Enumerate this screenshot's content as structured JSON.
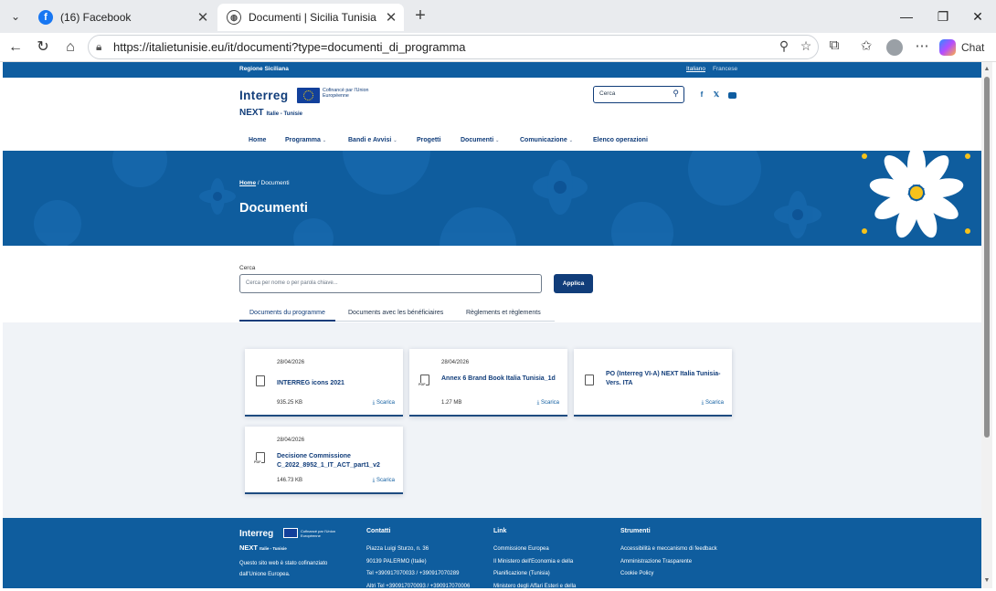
{
  "browser": {
    "tabs": [
      {
        "title": "(16) Facebook",
        "icon": "facebook-icon"
      },
      {
        "title": "Documenti | Sicilia Tunisia",
        "icon": "globe-icon"
      }
    ],
    "url": "https://italietunisie.eu/it/documenti?type=documenti_di_programma",
    "chat_label": "Chat"
  },
  "site": {
    "region": "Regione Siciliana",
    "lang_it": "Italiano",
    "lang_fr": "Francese",
    "logo_interreg": "Interreg",
    "logo_cofinance": "Cofinancé par l'Union Européenne",
    "logo_next": "NEXT",
    "logo_next_sub": "Italie - Tunisie",
    "search_placeholder": "Cerca",
    "social": {
      "facebook": "f",
      "x": "𝕏"
    },
    "nav": [
      "Home",
      "Programma",
      "Bandi e Avvisi",
      "Progetti",
      "Documenti",
      "Comunicazione",
      "Elenco operazioni"
    ],
    "breadcrumb_home": "Home",
    "breadcrumb_sep": "/",
    "breadcrumb_current": "Documenti",
    "page_title": "Documenti",
    "filter_label": "Cerca",
    "filter_placeholder": "Cerca per nome o per parola chiave...",
    "filter_button": "Applica",
    "doc_tabs": [
      "Documents du programme",
      "Documents avec les bénéficiaires",
      "Règlements et règlements"
    ]
  },
  "documents": [
    {
      "date": "28/04/2026",
      "title": "INTERREG icons 2021",
      "size": "935.25 KB",
      "download": "Scarica",
      "pdf": false
    },
    {
      "date": "28/04/2026",
      "title": "Annex 6 Brand Book Italia Tunisia_1d",
      "size": "1.27 MB",
      "download": "Scarica",
      "pdf": true
    },
    {
      "date": "",
      "title": "PO (Interreg VI-A) NEXT Italia Tunisia- Vers. ITA",
      "size": "",
      "download": "Scarica",
      "pdf": false
    },
    {
      "date": "28/04/2026",
      "title": "Decisione Commissione C_2022_8952_1_IT_ACT_part1_v2",
      "size": "146.73 KB",
      "download": "Scarica",
      "pdf": true
    }
  ],
  "footer": {
    "logo_interreg": "Interreg",
    "logo_cofinance": "Cofinancé par l'Union Européenne",
    "logo_next": "NEXT",
    "logo_next_sub": "Italie - Tunisie",
    "description": "Questo sito web è stato cofinanziato dall'Unione Europea.",
    "contatti": {
      "title": "Contatti",
      "lines": [
        "Piazza Luigi Sturzo, n. 36",
        "90139 PALERMO (Italie)",
        "Tel +390917070033 / +390917070289",
        "Altri Tel +390917070093 / +390917070006"
      ]
    },
    "link": {
      "title": "Link",
      "lines": [
        "Commissione Europea",
        "Il Ministero dell'Economia e della",
        "Pianificazione (Tunisia)",
        "Ministero degli Affari Esteri e della"
      ]
    },
    "strumenti": {
      "title": "Strumenti",
      "lines": [
        "Accessibilità e meccanismo di feedback",
        "Amministrazione Trasparente",
        "Cookie Policy"
      ]
    }
  },
  "colors": {
    "brand_blue": "#113d7a",
    "hero_blue": "#0f5d9e",
    "flower_yellow": "#f6c21a"
  }
}
